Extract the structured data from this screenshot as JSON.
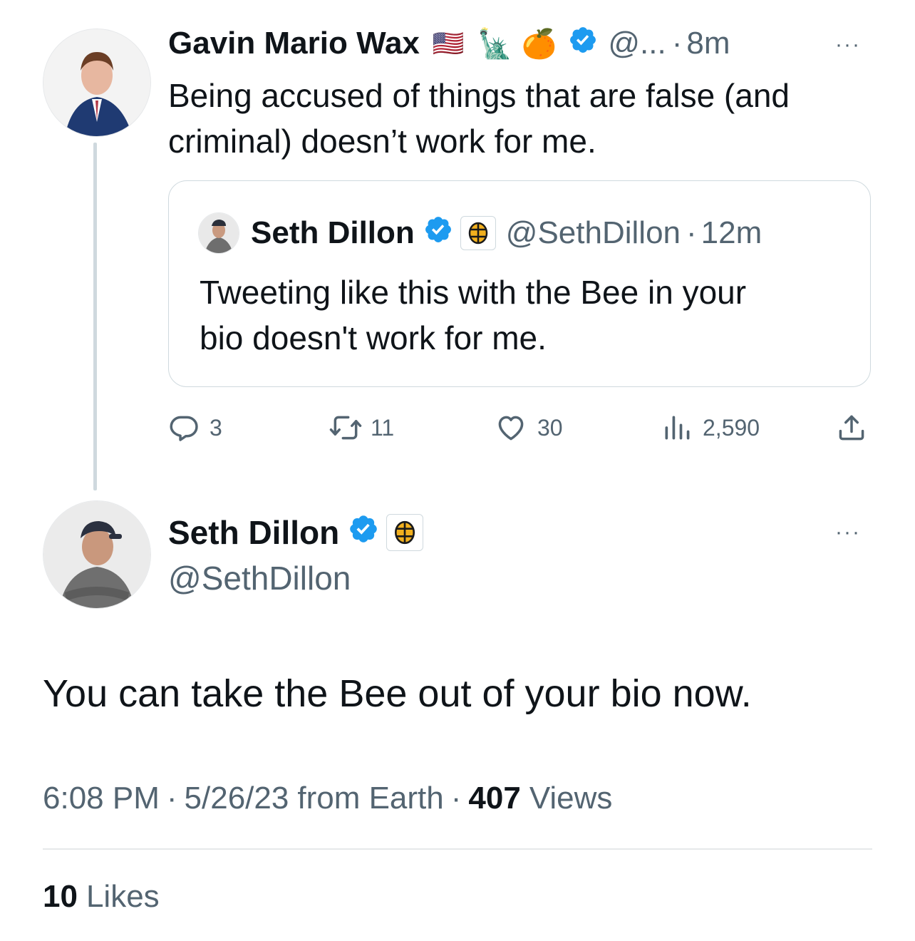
{
  "reply_to": {
    "name": "Gavin Mario Wax",
    "flag_emoji": "🇺🇸",
    "emoji_liberty": "🗽",
    "emoji_orange": "🍊",
    "handle": "@...",
    "sep": "·",
    "time": "8m",
    "more": "···",
    "text_line1": "Being accused of things that are false (and",
    "text_line2": "criminal) doesn’t work for me.",
    "quote": {
      "name": "Seth Dillon",
      "handle": "@SethDillon",
      "sep": "·",
      "time": "12m",
      "text_line1": "Tweeting like this with the Bee in your",
      "text_line2": "bio doesn't work for me."
    },
    "actions": {
      "replies": "3",
      "retweets": "11",
      "likes": "30",
      "views": "2,590"
    }
  },
  "main_tweet": {
    "name": "Seth Dillon",
    "handle": "@SethDillon",
    "more": "···",
    "text": "You can take the Bee out of your bio now.",
    "time": "6:08 PM",
    "sep1": "·",
    "date": "5/26/23",
    "source": "from Earth",
    "sep2": "·",
    "views_count": "407",
    "views_label": "Views",
    "likes_count": "10",
    "likes_label": "Likes"
  },
  "colors": {
    "verified_blue": "#1d9bf0",
    "muted_text": "#536471",
    "thread_line": "#cfd9de"
  },
  "icons": [
    "verified-badge-icon",
    "babylon-bee-badge-icon",
    "reply-icon",
    "retweet-icon",
    "like-icon",
    "views-icon",
    "share-icon",
    "more-icon"
  ]
}
